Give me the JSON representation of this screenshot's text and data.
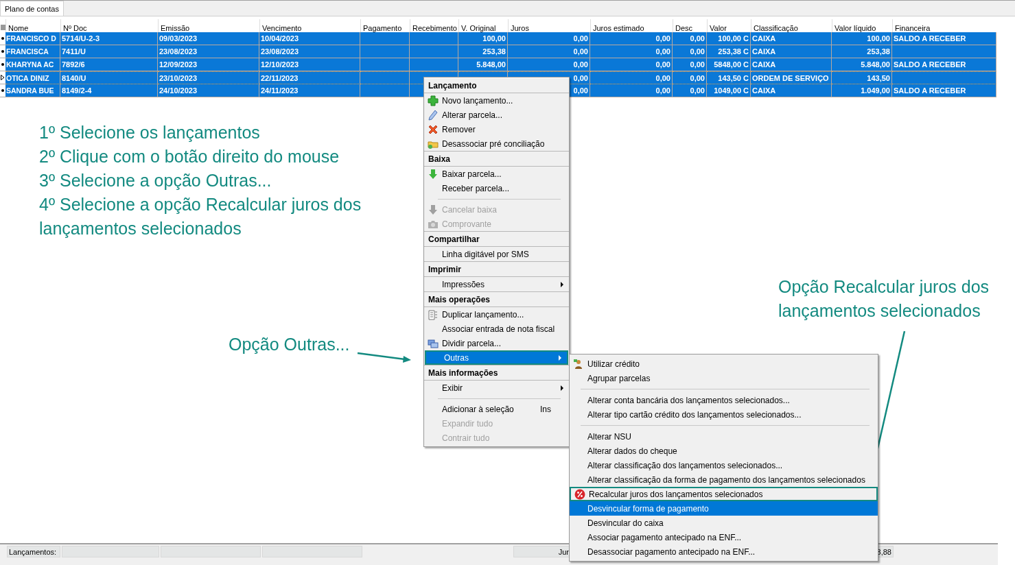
{
  "tabs": [
    {
      "label": "Plano de contas",
      "selected": true
    }
  ],
  "table": {
    "columns": [
      "Nome",
      "Nº Doc",
      "Emissão",
      "Vencimento",
      "Pagamento",
      "Recebimento",
      "V. Original",
      "Juros",
      "Juros estimado",
      "Desc",
      "Valor",
      "Classificação",
      "Valor líquido",
      "Financeira"
    ],
    "rows": [
      {
        "selected": true,
        "current": false,
        "cells": [
          "FRANCISCO D",
          "5714/U-2-3",
          "09/03/2023",
          "10/04/2023",
          "",
          "",
          "100,00",
          "0,00",
          "0,00",
          "0,00",
          "100,00 C",
          "CAIXA",
          "100,00",
          "SALDO A RECEBER"
        ]
      },
      {
        "selected": true,
        "current": false,
        "cells": [
          "FRANCISCA",
          "7411/U",
          "23/08/2023",
          "23/08/2023",
          "",
          "",
          "253,38",
          "0,00",
          "0,00",
          "0,00",
          "253,38 C",
          "CAIXA",
          "253,38",
          ""
        ]
      },
      {
        "selected": true,
        "current": false,
        "cells": [
          "KHARYNA AC",
          "7892/6",
          "12/09/2023",
          "12/10/2023",
          "",
          "",
          "5.848,00",
          "0,00",
          "0,00",
          "0,00",
          "5848,00 C",
          "CAIXA",
          "5.848,00",
          "SALDO A RECEBER"
        ]
      },
      {
        "selected": true,
        "current": true,
        "cells": [
          "OTICA DINIZ",
          "8140/U",
          "23/10/2023",
          "22/11/2023",
          "",
          "",
          "",
          "0,00",
          "0,00",
          "0,00",
          "143,50 C",
          "ORDEM DE SERVIÇO",
          "143,50",
          ""
        ]
      },
      {
        "selected": true,
        "current": false,
        "cells": [
          "SANDRA BUE",
          "8149/2-4",
          "24/10/2023",
          "24/11/2023",
          "",
          "",
          "",
          "0,00",
          "0,00",
          "0,00",
          "1049,00 C",
          "CAIXA",
          "1.049,00",
          "SALDO A RECEBER"
        ]
      }
    ]
  },
  "steps": [
    "1º Selecione os lançamentos",
    "2º Clique com o botão direito do mouse",
    "3º Selecione a opção Outras...",
    "4º Selecione a opção Recalcular juros dos lançamentos selecionados"
  ],
  "callouts": {
    "outras": "Opção Outras...",
    "recalcular": "Opção Recalcular juros dos lançamentos selecionados"
  },
  "context_menu": [
    {
      "kind": "header",
      "label": "Lançamento"
    },
    {
      "kind": "item",
      "label": "Novo lançamento...",
      "disabled": false,
      "selected": false
    },
    {
      "kind": "item",
      "label": "Alterar parcela...",
      "disabled": false,
      "selected": false
    },
    {
      "kind": "item",
      "label": "Remover",
      "disabled": false,
      "selected": false
    },
    {
      "kind": "item",
      "label": "Desassociar pré conciliação",
      "disabled": false,
      "selected": false
    },
    {
      "kind": "header",
      "label": "Baixa"
    },
    {
      "kind": "item",
      "label": "Baixar parcela...",
      "disabled": false,
      "selected": false
    },
    {
      "kind": "item",
      "label": "Receber parcela...",
      "disabled": false,
      "selected": false
    },
    {
      "kind": "separator"
    },
    {
      "kind": "item",
      "label": "Cancelar baixa",
      "disabled": true,
      "selected": false
    },
    {
      "kind": "item",
      "label": "Comprovante",
      "disabled": true,
      "selected": false
    },
    {
      "kind": "header",
      "label": "Compartilhar"
    },
    {
      "kind": "item",
      "label": "Linha digitável por SMS",
      "disabled": false,
      "selected": false
    },
    {
      "kind": "header",
      "label": "Imprimir"
    },
    {
      "kind": "item",
      "label": "Impressões",
      "disabled": false,
      "selected": false,
      "submenu": true
    },
    {
      "kind": "header",
      "label": "Mais operações"
    },
    {
      "kind": "item",
      "label": "Duplicar lançamento...",
      "disabled": false,
      "selected": false
    },
    {
      "kind": "item",
      "label": "Associar entrada de nota fiscal",
      "disabled": false,
      "selected": false
    },
    {
      "kind": "item",
      "label": "Dividir parcela...",
      "disabled": false,
      "selected": false
    },
    {
      "kind": "item",
      "label": "Outras",
      "disabled": false,
      "selected": true,
      "submenu": true
    },
    {
      "kind": "header",
      "label": "Mais informações"
    },
    {
      "kind": "item",
      "label": "Exibir",
      "disabled": false,
      "selected": false,
      "submenu": true
    },
    {
      "kind": "separator"
    },
    {
      "kind": "item",
      "label": "Adicionar à seleção",
      "shortcut": "Ins",
      "disabled": false,
      "selected": false
    },
    {
      "kind": "item",
      "label": "Expandir tudo",
      "disabled": true,
      "selected": false
    },
    {
      "kind": "item",
      "label": "Contrair tudo",
      "disabled": true,
      "selected": false
    }
  ],
  "submenu": [
    {
      "kind": "item",
      "label": "Utilizar crédito",
      "selected": false,
      "highlighted": false
    },
    {
      "kind": "item",
      "label": "Agrupar parcelas",
      "selected": false,
      "highlighted": false
    },
    {
      "kind": "separator"
    },
    {
      "kind": "item",
      "label": "Alterar conta bancária dos lançamentos selecionados...",
      "selected": false,
      "highlighted": false
    },
    {
      "kind": "item",
      "label": "Alterar tipo cartão crédito dos lançamentos selecionados...",
      "selected": false,
      "highlighted": false
    },
    {
      "kind": "separator"
    },
    {
      "kind": "item",
      "label": "Alterar NSU",
      "selected": false,
      "highlighted": false
    },
    {
      "kind": "item",
      "label": "Alterar dados do cheque",
      "selected": false,
      "highlighted": false
    },
    {
      "kind": "item",
      "label": "Alterar classificação dos lançamentos selecionados...",
      "selected": false,
      "highlighted": false
    },
    {
      "kind": "item",
      "label": "Alterar classificação da forma de pagamento dos lançamentos selecionados",
      "selected": false,
      "highlighted": false
    },
    {
      "kind": "item",
      "label": "Recalcular juros dos lançamentos selecionados",
      "selected": false,
      "highlighted": true
    },
    {
      "kind": "item",
      "label": "Desvincular forma de pagamento",
      "selected": true,
      "highlighted": false
    },
    {
      "kind": "item",
      "label": "Desvincular do caixa",
      "selected": false,
      "highlighted": false
    },
    {
      "kind": "item",
      "label": "Associar pagamento antecipado na ENF...",
      "selected": false,
      "highlighted": false
    },
    {
      "kind": "item",
      "label": "Desassociar pagamento antecipado na ENF...",
      "selected": false,
      "highlighted": false
    }
  ],
  "status_bar": {
    "cells": [
      "Lançamentos:",
      "",
      "",
      "",
      "Jur",
      "3,88"
    ]
  }
}
